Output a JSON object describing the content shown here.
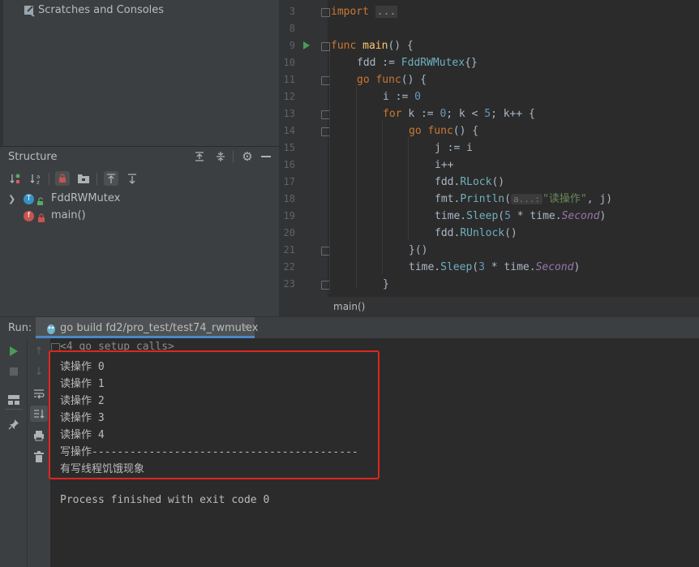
{
  "project": {
    "scratches_label": "Scratches and Consoles"
  },
  "structure": {
    "title": "Structure",
    "items": [
      {
        "label": "FddRWMutex",
        "badge": "T"
      },
      {
        "label": "main()",
        "badge": "f"
      }
    ]
  },
  "editor": {
    "line_numbers": [
      "3",
      "8",
      "9",
      "10",
      "11",
      "12",
      "13",
      "14",
      "15",
      "16",
      "17",
      "18",
      "19",
      "20",
      "21",
      "22",
      "23"
    ],
    "code": {
      "l3_import": "import",
      "l3_fold": "...",
      "l9_func": "func",
      "l9_name": "main",
      "l9_rest": "() {",
      "l10_a": "fdd := ",
      "l10_type": "FddRWMutex",
      "l10_b": "{}",
      "l11_go": "go ",
      "l11_func": "func",
      "l11_rest": "() {",
      "l12_a": "i := ",
      "l12_num": "0",
      "l13_for": "for ",
      "l13_a": "k := ",
      "l13_n0": "0",
      "l13_b": "; k < ",
      "l13_n5": "5",
      "l13_c": "; k++ {",
      "l14_go": "go ",
      "l14_func": "func",
      "l14_rest": "() {",
      "l15": "j := i",
      "l16": "i++",
      "l17_a": "fdd.",
      "l17_fn": "RLock",
      "l17_b": "()",
      "l18_a": "fmt.",
      "l18_fn": "Println",
      "l18_b": "(",
      "l18_hint": "a...:",
      "l18_str": "\"读操作\"",
      "l18_c": ", j)",
      "l19_a": "time.",
      "l19_fn": "Sleep",
      "l19_b": "(",
      "l19_num": "5",
      "l19_c": " * time.",
      "l19_it": "Second",
      "l19_d": ")",
      "l20_a": "fdd.",
      "l20_fn": "RUnlock",
      "l20_b": "()",
      "l21": "}()",
      "l22_a": "time.",
      "l22_fn": "Sleep",
      "l22_b": "(",
      "l22_num": "3",
      "l22_c": " * time.",
      "l22_it": "Second",
      "l22_d": ")",
      "l23": "}"
    },
    "breadcrumb": "main()"
  },
  "run": {
    "label": "Run:",
    "tab_label": "go build fd2/pro_test/test74_rwmutex",
    "output": [
      "<4 go setup calls>",
      "读操作 0",
      "读操作 1",
      "读操作 2",
      "读操作 3",
      "读操作 4",
      "写操作------------------------------------------",
      "有写线程饥饿现象",
      "",
      "Process finished with exit code 0"
    ]
  },
  "colors": {
    "highlight_border": "#e0261f",
    "run_green": "#499c54"
  }
}
